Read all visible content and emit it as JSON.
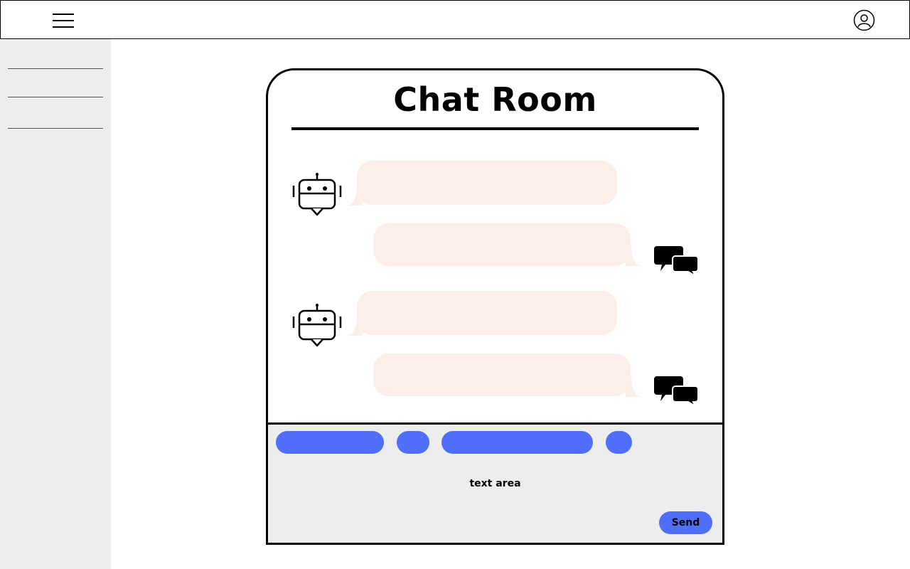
{
  "header": {
    "menu_icon": "hamburger-menu-icon",
    "profile_icon": "user-circle-icon"
  },
  "chat": {
    "title": "Chat Room",
    "bot_icon": "robot-icon",
    "user_icon": "chat-bubbles-icon",
    "bubble_color": "#fdeeea"
  },
  "composer": {
    "placeholder": "text area",
    "send_label": "Send",
    "chip_color": "#4f6ffa",
    "background": "#ededed"
  }
}
